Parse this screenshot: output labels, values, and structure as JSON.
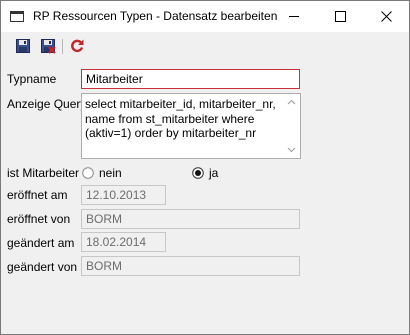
{
  "window": {
    "title": "RP Ressourcen Typen - Datensatz bearbeiten",
    "icon": "window-icon",
    "controls": [
      "minimize-icon",
      "maximize-icon",
      "close-icon"
    ]
  },
  "toolbar": {
    "buttons": [
      {
        "icon": "save-icon"
      },
      {
        "icon": "save-close-icon"
      },
      {
        "icon": "refresh-icon"
      }
    ]
  },
  "form": {
    "typname": {
      "label": "Typname",
      "value": "Mitarbeiter"
    },
    "anzeige_query": {
      "label": "Anzeige Query",
      "value": "select mitarbeiter_id, mitarbeiter_nr, name from st_mitarbeiter where (aktiv=1) order by mitarbeiter_nr"
    },
    "ist_mitarbeiter": {
      "label": "ist Mitarbeiter",
      "options": [
        "nein",
        "ja"
      ],
      "selected": "ja"
    },
    "eroeffnet_am": {
      "label": "eröffnet am",
      "value": "12.10.2013"
    },
    "eroeffnet_von": {
      "label": "eröffnet von",
      "value": "BORM"
    },
    "geaendert_am": {
      "label": "geändert am",
      "value": "18.02.2014"
    },
    "geaendert_von": {
      "label": "geändert von",
      "value": "BORM"
    }
  },
  "colors": {
    "accent_border": "#c8323b",
    "window_bg": "#f0f0f0",
    "refresh_icon": "#c0282e"
  }
}
